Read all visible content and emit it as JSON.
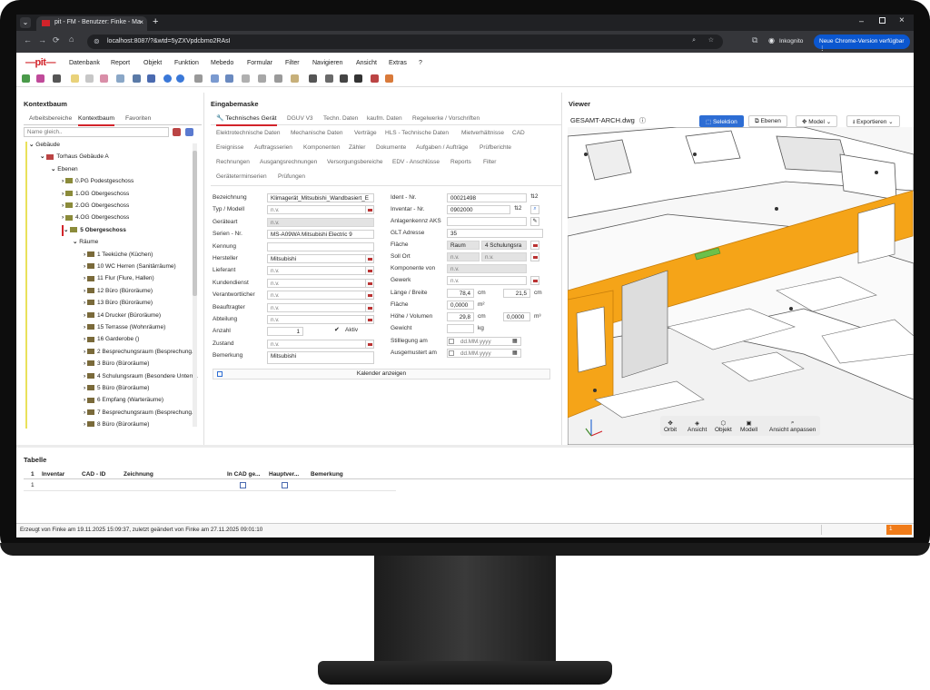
{
  "browser": {
    "tab_title": "pit - FM - Benutzer: Finke - Ma",
    "url": "localhost:8087/?&wtd=5yZXVpdcbmo2RAsI",
    "incognito_label": "Inkognito",
    "update_label": "Neue Chrome-Version verfügbar"
  },
  "app": {
    "logo": "—pit—",
    "menu": [
      "Datenbank",
      "Report",
      "Objekt",
      "Funktion",
      "Mebedo",
      "Formular",
      "Filter",
      "Navigieren",
      "Ansicht",
      "Extras",
      "?"
    ]
  },
  "left": {
    "title": "Kontextbaum",
    "tabs": [
      "Arbeitsbereiche",
      "Kontextbaum",
      "Favoriten"
    ],
    "search_placeholder": "Name gleich..",
    "tree": [
      {
        "label": "Gebäude",
        "level": 0,
        "icon": "none",
        "exp": "v"
      },
      {
        "label": "Torhaus Gebäude A",
        "level": 1,
        "icon": "building",
        "exp": "v"
      },
      {
        "label": "Ebenen",
        "level": 2,
        "icon": "none",
        "exp": "v"
      },
      {
        "label": "0.PG Podestgeschoss",
        "level": 3,
        "icon": "floor",
        "exp": ">"
      },
      {
        "label": "1.OG Obergeschoss",
        "level": 3,
        "icon": "floor",
        "exp": ">"
      },
      {
        "label": "2.OG Obergeschoss",
        "level": 3,
        "icon": "floor",
        "exp": ">"
      },
      {
        "label": "4.OG Obergeschoss",
        "level": 3,
        "icon": "floor",
        "exp": ">"
      },
      {
        "label": "5 Obergeschoss",
        "level": 3,
        "icon": "floor",
        "exp": "v",
        "bold": true
      },
      {
        "label": "Räume",
        "level": 4,
        "icon": "none",
        "exp": "v"
      },
      {
        "label": "1 Teeküche (Küchen)",
        "level": 5,
        "icon": "room",
        "exp": ">"
      },
      {
        "label": "10 WC Herren (Sanitärräume)",
        "level": 5,
        "icon": "room",
        "exp": ">"
      },
      {
        "label": "11 Flur (Flure, Hallen)",
        "level": 5,
        "icon": "room",
        "exp": ">"
      },
      {
        "label": "12 Büro (Büroräume)",
        "level": 5,
        "icon": "room",
        "exp": ">"
      },
      {
        "label": "13 Büro (Büroräume)",
        "level": 5,
        "icon": "room",
        "exp": ">"
      },
      {
        "label": "14 Drucker (Büroräume)",
        "level": 5,
        "icon": "room",
        "exp": ">"
      },
      {
        "label": "15 Terrasse (Wohnräume)",
        "level": 5,
        "icon": "room",
        "exp": ">"
      },
      {
        "label": "16 Garderobe ()",
        "level": 5,
        "icon": "room",
        "exp": ">"
      },
      {
        "label": "2 Besprechungsraum (Besprechung...",
        "level": 5,
        "icon": "room",
        "exp": ">"
      },
      {
        "label": "3 Büro (Büroräume)",
        "level": 5,
        "icon": "room",
        "exp": ">"
      },
      {
        "label": "4 Schulungsraum (Besondere Unterr...",
        "level": 5,
        "icon": "room",
        "exp": ">"
      },
      {
        "label": "5 Büro (Büroräume)",
        "level": 5,
        "icon": "room",
        "exp": ">"
      },
      {
        "label": "6 Empfang (Warteräume)",
        "level": 5,
        "icon": "room",
        "exp": ">"
      },
      {
        "label": "7 Besprechungsraum (Besprechung...",
        "level": 5,
        "icon": "room",
        "exp": ">"
      },
      {
        "label": "8 Büro (Büroräume)",
        "level": 5,
        "icon": "room",
        "exp": ">"
      }
    ]
  },
  "middle": {
    "title": "Eingabemaske",
    "tab_row1": [
      "Technisches Gerät",
      "DGUV V3",
      "Techn. Daten",
      "kaufm. Daten",
      "Regelwerke / Vorschriften"
    ],
    "tab_row2": [
      "Elektrotechnische Daten",
      "Mechanische Daten",
      "Verträge",
      "HLS - Technische Daten",
      "Mietverhältnisse",
      "CAD"
    ],
    "tab_row3": [
      "Ereignisse",
      "Auftragsserien",
      "Komponenten",
      "Zähler",
      "Dokumente",
      "Aufgaben / Aufträge",
      "Prüfberichte"
    ],
    "tab_row4": [
      "Rechnungen",
      "Ausgangsrechnungen",
      "Versorgungsbereiche",
      "EDV - Anschlüsse",
      "Reports",
      "Filter"
    ],
    "tab_row5": [
      "Geräteterminserien",
      "Prüfungen"
    ],
    "left_fields": [
      {
        "label": "Bezeichnung",
        "value": "Klimagerät_Mitsubishi_Wandbasiert_E"
      },
      {
        "label": "Typ / Modell",
        "value": "n.v."
      },
      {
        "label": "Geräteart",
        "value": "n.v."
      },
      {
        "label": "Serien - Nr.",
        "value": "MS-A09WA Mitsubishi Electric 9"
      },
      {
        "label": "Kennung",
        "value": ""
      },
      {
        "label": "Hersteller",
        "value": "Mitsubishi"
      },
      {
        "label": "Lieferant",
        "value": "n.v."
      },
      {
        "label": "Kundendienst",
        "value": "n.v."
      },
      {
        "label": "Verantwortlicher",
        "value": "n.v."
      },
      {
        "label": "Beauftragter",
        "value": "n.v."
      },
      {
        "label": "Abteilung",
        "value": "n.v."
      },
      {
        "label": "Anzahl",
        "value": "1"
      },
      {
        "label": "Zustand",
        "value": "n.v."
      },
      {
        "label": "Bemerkung",
        "value": "Mitsubishi"
      }
    ],
    "aktiv_label": "Aktiv",
    "aktiv_check": "✔",
    "right": {
      "ident_label": "Ident - Nr.",
      "ident_value": "00021498",
      "inventar_label": "Inventar - Nr.",
      "inventar_value": "0902000",
      "anlagen_label": "Anlagenkennz AKS",
      "glt_label": "GLT Adresse",
      "glt_value": "35",
      "flaeche_label": "Fläche",
      "flaeche_a": "Raum",
      "flaeche_b": "4 Schulungsra",
      "sollort_label": "Soll Ort",
      "sollort_a": "n.v.",
      "sollort_b": "n.v.",
      "komponente_label": "Komponente von",
      "komponente_value": "n.v.",
      "gewerk_label": "Gewerk",
      "gewerk_value": "n.v.",
      "laenge_label": "Länge / Breite",
      "laenge_value": "78,4",
      "breite_value": "21,5",
      "unit_cm": "cm",
      "flaeche2_label": "Fläche",
      "flaeche2_value": "0,0000",
      "unit_m2": "m²",
      "hoehe_label": "Höhe / Volumen",
      "hoehe_value": "29,8",
      "volumen_value": "0,0000",
      "unit_m3": "m³",
      "gewicht_label": "Gewicht",
      "unit_kg": "kg",
      "stilllegung_label": "Stilllegung am",
      "stilllegung_value": "dd.MM.yyyy",
      "ausgemustert_label": "Ausgemustert am",
      "ausgemustert_value": "dd.MM.yyyy"
    },
    "calendar_button": "Kalender anzeigen"
  },
  "viewer": {
    "title": "Viewer",
    "file": "GESAMT-ARCH.dwg",
    "buttons": [
      "Selektion",
      "Ebenen",
      "Model",
      "Exportieren"
    ],
    "nav": [
      "Orbit",
      "Ansicht",
      "Objekt",
      "Modell",
      "Ansicht anpassen"
    ],
    "colors": {
      "highlight": "#f5a418",
      "selected_device": "#6cc04a",
      "accent_button": "#2d6dd4"
    }
  },
  "table": {
    "title": "Tabelle",
    "columns": [
      "1",
      "Inventar",
      "CAD - ID",
      "Zeichnung",
      "In CAD ge...",
      "Hauptver...",
      "Bemerkung"
    ],
    "rows": [
      [
        "1",
        "",
        "",
        "",
        "",
        "",
        ""
      ]
    ]
  },
  "status": {
    "text": "Erzeugt von Finke am 19.11.2025 15:09:37, zuletzt geändert von Finke am 27.11.2025 09:01:10",
    "badge": "1"
  }
}
